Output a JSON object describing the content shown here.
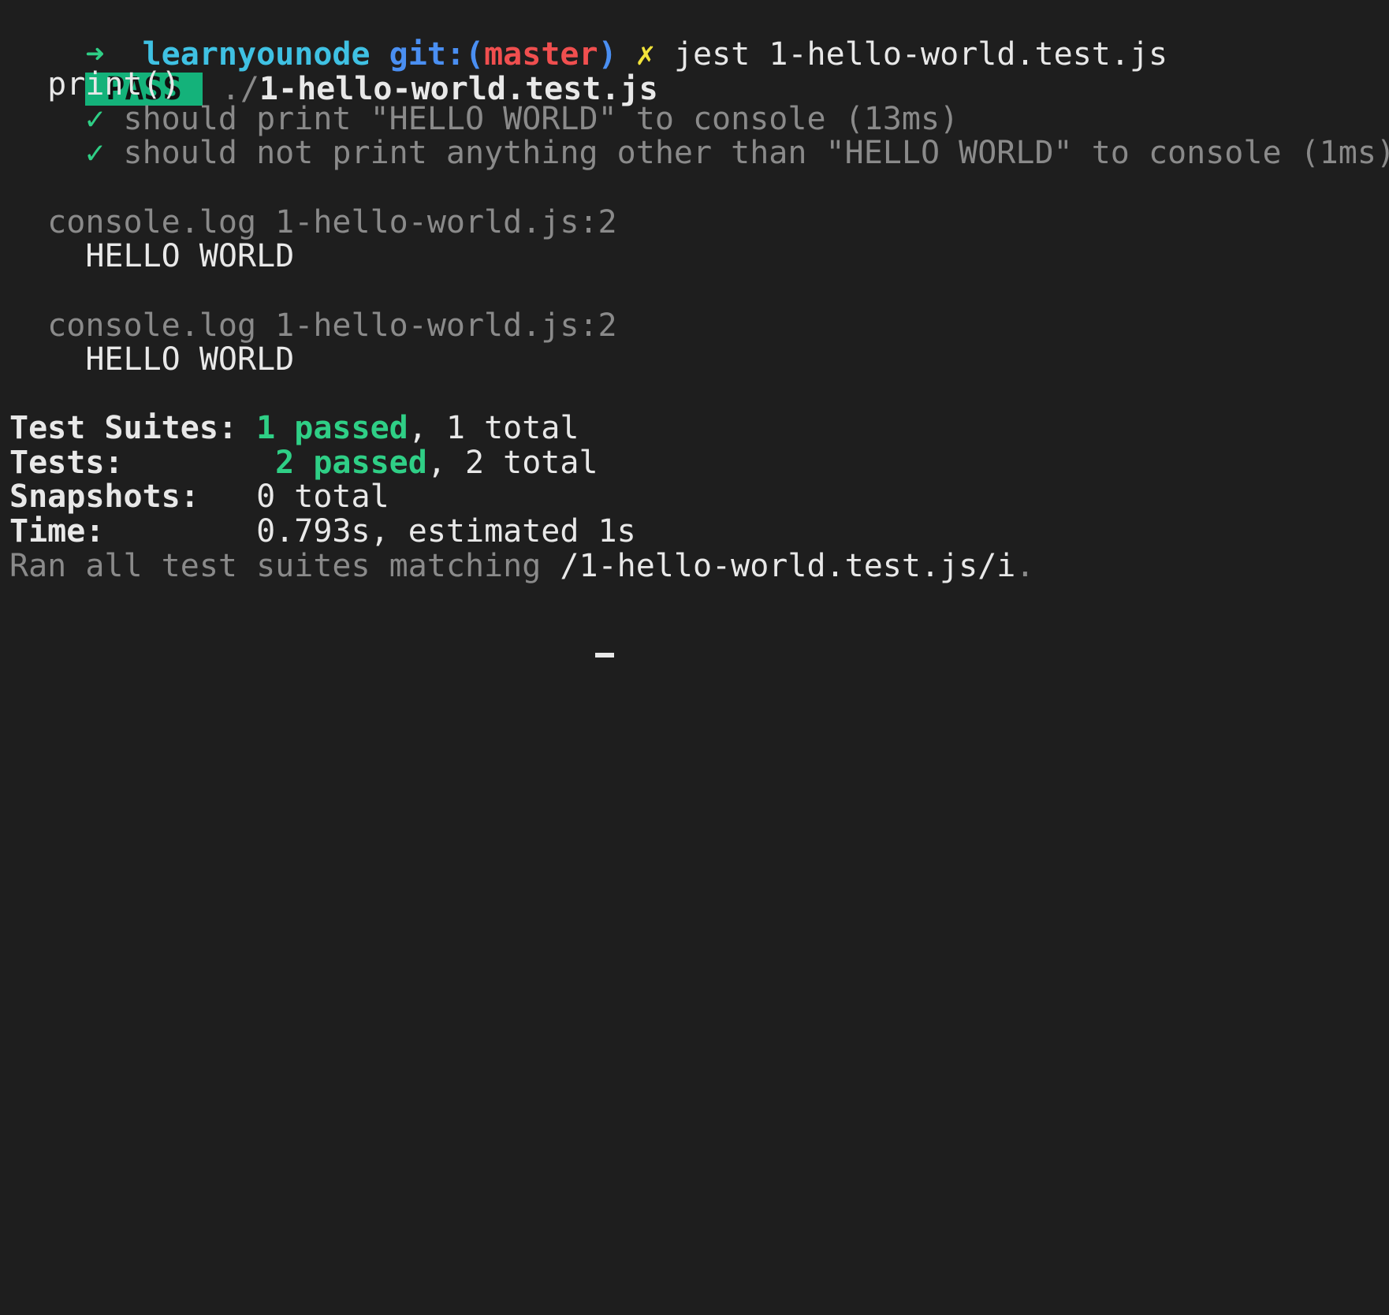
{
  "prompt": {
    "arrow": "➜",
    "directory": "learnyounode",
    "git_prefix": "git:(",
    "branch": "master",
    "git_suffix": ")",
    "dirty_mark": "✗",
    "command": "jest 1-hello-world.test.js"
  },
  "result": {
    "badge": "PASS",
    "path_prefix": "./",
    "file": "1-hello-world.test.js"
  },
  "suite": {
    "name": "print()",
    "tests": [
      {
        "mark": "✓",
        "text": "should print \"HELLO WORLD\" to console (13ms)"
      },
      {
        "mark": "✓",
        "text": "should not print anything other than \"HELLO WORLD\" to console (1ms)"
      }
    ]
  },
  "console_logs": [
    {
      "source": "console.log 1-hello-world.js:2",
      "output": "HELLO WORLD"
    },
    {
      "source": "console.log 1-hello-world.js:2",
      "output": "HELLO WORLD"
    }
  ],
  "summary": {
    "suites_label": "Test Suites: ",
    "suites_passed": "1 passed",
    "suites_rest": ", 1 total",
    "tests_label": "Tests:        ",
    "tests_passed": "2 passed",
    "tests_rest": ", 2 total",
    "snapshots_label": "Snapshots:   ",
    "snapshots_value": "0 total",
    "time_label": "Time:        ",
    "time_value": "0.793s, estimated 1s",
    "ran_prefix": "Ran all test suites matching ",
    "ran_pattern": "/1-hello-world.test.js/i",
    "ran_suffix": "."
  },
  "colors": {
    "background": "#1e1e1e",
    "pass_green": "#14b27a",
    "success_green": "#2fcf86",
    "branch_red": "#f04f4f",
    "dirty_yellow": "#f2e33a"
  }
}
